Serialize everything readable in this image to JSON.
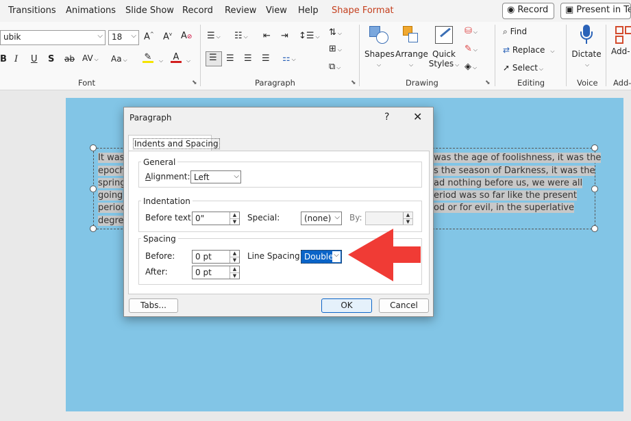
{
  "tabs": [
    "Transitions",
    "Animations",
    "Slide Show",
    "Record",
    "Review",
    "View",
    "Help",
    "Shape Format"
  ],
  "top_buttons": {
    "record": "Record",
    "present": "Present in Tea"
  },
  "font_group": {
    "font_name": "ubik",
    "font_size": "18",
    "label": "Font"
  },
  "paragraph_group": {
    "label": "Paragraph"
  },
  "drawing_group": {
    "shapes": "Shapes",
    "arrange": "Arrange",
    "quick_styles_1": "Quick",
    "quick_styles_2": "Styles",
    "label": "Drawing"
  },
  "editing_group": {
    "find": "Find",
    "replace": "Replace",
    "select": "Select",
    "label": "Editing"
  },
  "voice_group": {
    "dictate": "Dictate",
    "label": "Voice"
  },
  "addins_group": {
    "addins": "Add-",
    "label": "Add-"
  },
  "slide_text_lines": [
    "It was",
    "epoch",
    "spring",
    "going",
    "period",
    "degre"
  ],
  "slide_text_right": [
    "was the age of foolishness, it was the",
    "s the season of Darkness, it was the",
    "ad nothing before us, we were all",
    "eriod was so far like the present",
    "od or for evil, in the superlative",
    ""
  ],
  "dialog": {
    "title": "Paragraph",
    "help": "?",
    "close": "✕",
    "tab": "Indents and Spacing",
    "general": {
      "legend": "General",
      "alignment_label": "Alignment:",
      "alignment_value": "Left"
    },
    "indentation": {
      "legend": "Indentation",
      "before_text_label": "Before text:",
      "before_text_value": "0\"",
      "special_label": "Special:",
      "special_value": "(none)",
      "by_label": "By:"
    },
    "spacing": {
      "legend": "Spacing",
      "before_label": "Before:",
      "before_value": "0 pt",
      "after_label": "After:",
      "after_value": "0 pt",
      "line_spacing_label": "Line Spacing:",
      "line_spacing_value": "Double"
    },
    "buttons": {
      "tabs": "Tabs...",
      "ok": "OK",
      "cancel": "Cancel"
    }
  },
  "colors": {
    "slide_bg": "#82c5e6",
    "accent_tab": "#c43e1c",
    "arrow": "#f03b35",
    "selection": "#0a64c8"
  }
}
